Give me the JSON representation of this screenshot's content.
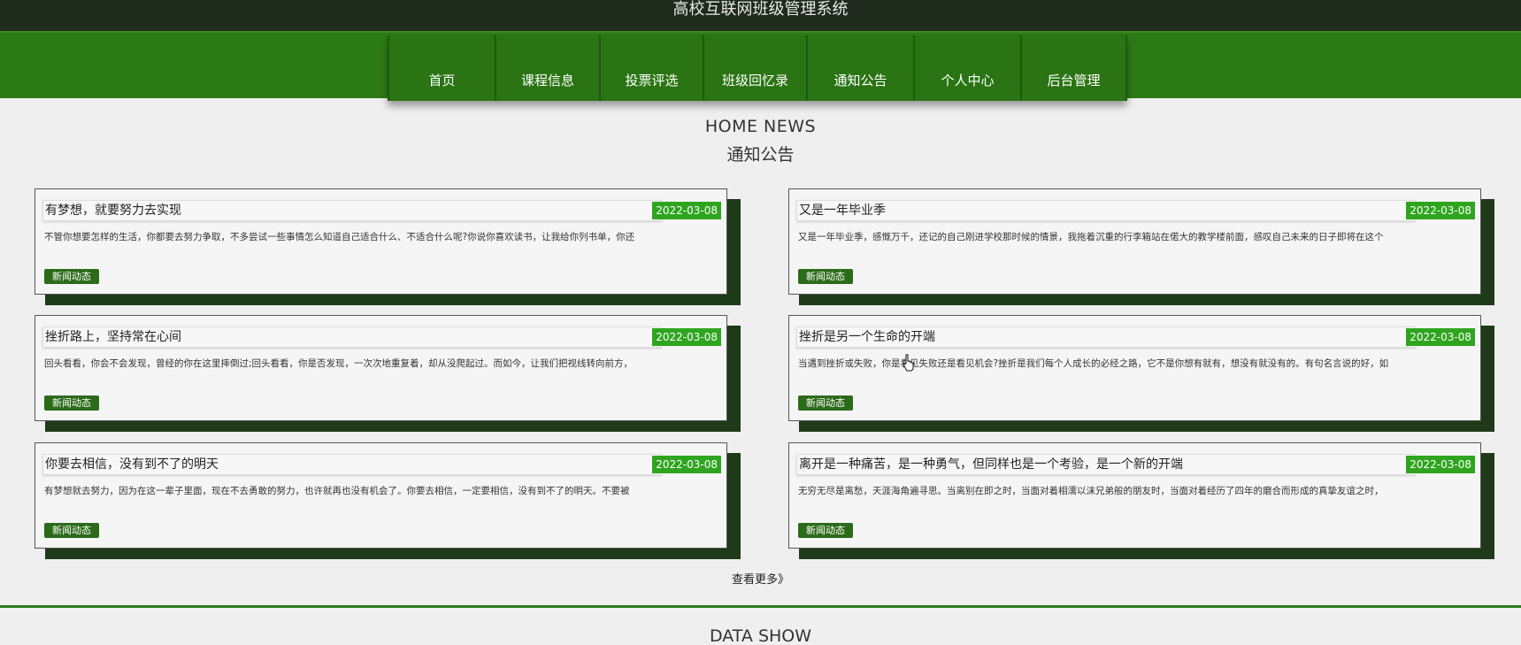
{
  "app_title": "高校互联网班级管理系统",
  "nav": [
    {
      "label": "首页"
    },
    {
      "label": "课程信息"
    },
    {
      "label": "投票评选"
    },
    {
      "label": "班级回忆录"
    },
    {
      "label": "通知公告"
    },
    {
      "label": "个人中心"
    },
    {
      "label": "后台管理"
    }
  ],
  "section": {
    "en": "HOME NEWS",
    "cn": "通知公告"
  },
  "news": [
    {
      "title": "有梦想，就要努力去实现",
      "date": "2022-03-08",
      "desc": "不管你想要怎样的生活，你都要去努力争取，不多尝试一些事情怎么知道自己适合什么、不适合什么呢?你说你喜欢读书，让我给你列书单，你还",
      "tag": "新闻动态"
    },
    {
      "title": "又是一年毕业季",
      "date": "2022-03-08",
      "desc": "又是一年毕业季，感慨万千，还记的自己刚进学校那时候的情景，我拖着沉重的行李箱站在偌大的教学楼前面，感叹自己未来的日子即将在这个",
      "tag": "新闻动态"
    },
    {
      "title": "挫折路上，坚持常在心间",
      "date": "2022-03-08",
      "desc": "回头看看，你会不会发现，曾经的你在这里摔倒过;回头看看，你是否发现，一次次地重复着，却从没爬起过。而如今，让我们把视线转向前方，",
      "tag": "新闻动态"
    },
    {
      "title": "挫折是另一个生命的开端",
      "date": "2022-03-08",
      "desc": "当遇到挫折或失败，你是看见失败还是看见机会?挫折是我们每个人成长的必经之路，它不是你想有就有，想没有就没有的。有句名言说的好，如",
      "tag": "新闻动态"
    },
    {
      "title": "你要去相信，没有到不了的明天",
      "date": "2022-03-08",
      "desc": "有梦想就去努力，因为在这一辈子里面，现在不去勇敢的努力，也许就再也没有机会了。你要去相信，一定要相信，没有到不了的明天。不要被",
      "tag": "新闻动态"
    },
    {
      "title": "离开是一种痛苦，是一种勇气，但同样也是一个考验，是一个新的开端",
      "date": "2022-03-08",
      "desc": "无穷无尽是离愁，天涯海角遍寻思。当离别在即之时，当面对着相濡以沫兄弟般的朋友时，当面对着经历了四年的磨合而形成的真挚友谊之时，",
      "tag": "新闻动态"
    }
  ],
  "more_label": "查看更多》",
  "data_show": "DATA SHOW"
}
